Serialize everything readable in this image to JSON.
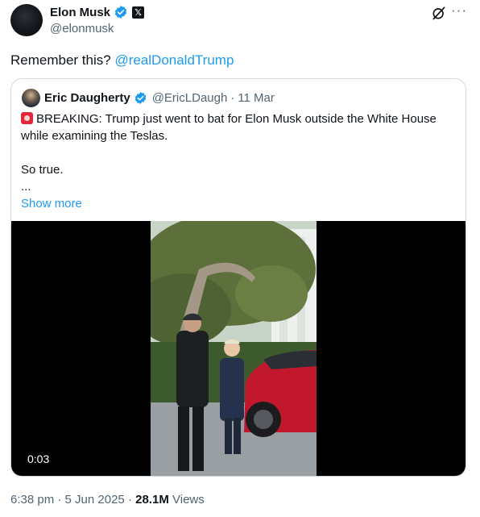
{
  "author": {
    "name": "Elon Musk",
    "handle": "@elonmusk",
    "x_badge": "𝕏"
  },
  "post": {
    "text": "Remember this? ",
    "mention": "@realDonaldTrump"
  },
  "quote": {
    "name": "Eric Daugherty",
    "handle": "@EricLDaugh",
    "separator": "·",
    "date": "11 Mar",
    "line1": "BREAKING: Trump just went to bat for Elon Musk outside the White House while examining the Teslas.",
    "line2": "So true.",
    "line3": "...",
    "show_more": "Show more",
    "video_time": "0:03"
  },
  "meta": {
    "time": "6:38 pm",
    "date": "5 Jun 2025",
    "views": "28.1M",
    "views_label": "Views",
    "sep": "·"
  },
  "colors": {
    "accent": "#1d9bf0",
    "muted": "#536471",
    "text": "#0f1419"
  },
  "icons": [
    "verified-badge-icon",
    "x-logo-icon",
    "grok-icon",
    "more-options-icon",
    "siren-emoji-icon"
  ]
}
